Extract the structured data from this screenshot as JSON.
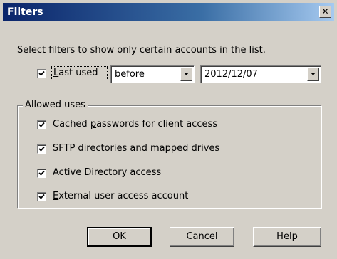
{
  "window": {
    "title": "Filters",
    "close_glyph": "✕"
  },
  "intro_text": "Select filters to show only certain accounts in the list.",
  "last_used": {
    "checked": true,
    "label_mnemonic": "L",
    "label_rest": "ast used",
    "operator_value": "before",
    "date_value": "2012/12/07"
  },
  "allowed_uses": {
    "group_label": "Allowed uses",
    "items": [
      {
        "checked": true,
        "pre": "Cached ",
        "mnemonic": "p",
        "post": "asswords for client access"
      },
      {
        "checked": true,
        "pre": "SFTP ",
        "mnemonic": "d",
        "post": "irectories and mapped drives"
      },
      {
        "checked": true,
        "pre": "",
        "mnemonic": "A",
        "post": "ctive Directory access"
      },
      {
        "checked": true,
        "pre": "",
        "mnemonic": "E",
        "post": "xternal user access account"
      }
    ]
  },
  "buttons": {
    "ok": {
      "mnemonic": "O",
      "rest": "K"
    },
    "cancel": {
      "mnemonic": "C",
      "rest": "ancel"
    },
    "help": {
      "mnemonic": "H",
      "rest": "elp"
    }
  },
  "icons": {
    "close": "close-icon",
    "checkmark": "checkmark-icon",
    "dropdown": "chevron-down-icon"
  },
  "colors": {
    "titlebar_start": "#0a246a",
    "titlebar_end": "#a6caf0",
    "dialog_bg": "#d4d0c8"
  }
}
